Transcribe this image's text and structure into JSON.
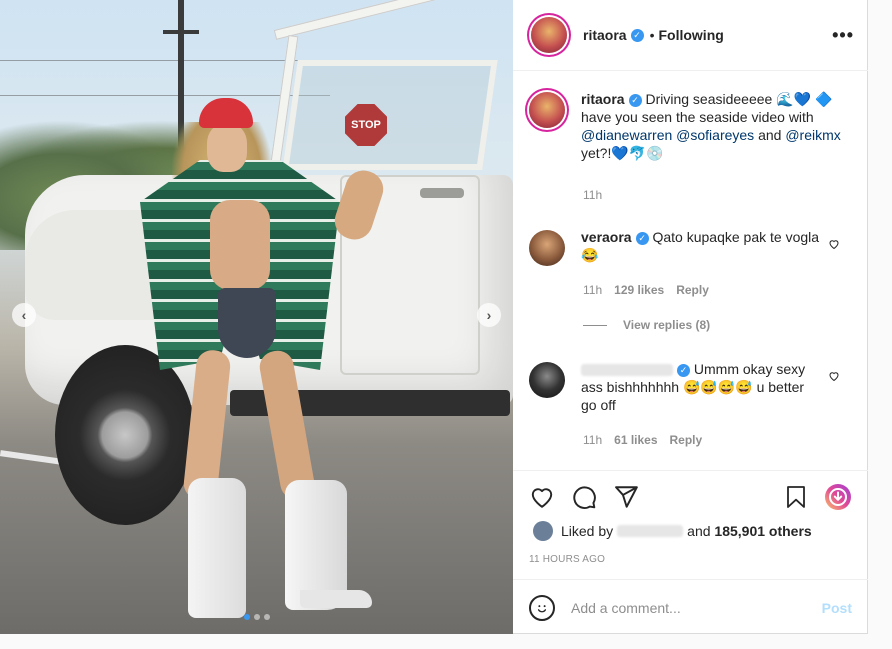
{
  "post": {
    "username": "ritaora",
    "follow_separator": "•",
    "follow_status": "Following",
    "more_label": "•••"
  },
  "photo": {
    "stop_sign_text": "STOP",
    "prev_arrow": "‹",
    "next_arrow": "›",
    "carousel_dots": 3,
    "active_dot": 0
  },
  "caption": {
    "username": "ritaora",
    "text_1": "Driving seasideeeee 🌊💙 🔷 have you seen the seaside video with ",
    "mention_1": "@dianewarren",
    "space_1": " ",
    "mention_2": "@sofiareyes",
    "text_2": " and ",
    "mention_3": "@reikmx",
    "text_3": " yet?!💙🐬💿",
    "time": "11h"
  },
  "comments": [
    {
      "username": "veraora",
      "text": "Qato kupaqke pak te vogla 😂",
      "time": "11h",
      "likes": "129 likes",
      "reply": "Reply",
      "view_replies": "View replies (8)"
    },
    {
      "text": "Ummm okay sexy ass bishhhhhhh 😅😅😅😅 u better go off",
      "time": "11h",
      "likes": "61 likes",
      "reply": "Reply"
    }
  ],
  "likes_summary": {
    "prefix": "Liked by",
    "middle": "and",
    "count": "185,901 others"
  },
  "timestamp": "11 HOURS AGO",
  "composer": {
    "placeholder": "Add a comment...",
    "post_label": "Post"
  },
  "colors": {
    "verified_blue": "#3897f0",
    "link_blue": "#00376b",
    "muted": "#8e8e8e",
    "post_disabled": "#b2dffc"
  },
  "icons": [
    "verified-icon",
    "heart-icon",
    "comment-icon",
    "share-icon",
    "bookmark-icon",
    "reels-icon",
    "emoji-icon",
    "chevron-left-icon",
    "chevron-right-icon"
  ]
}
